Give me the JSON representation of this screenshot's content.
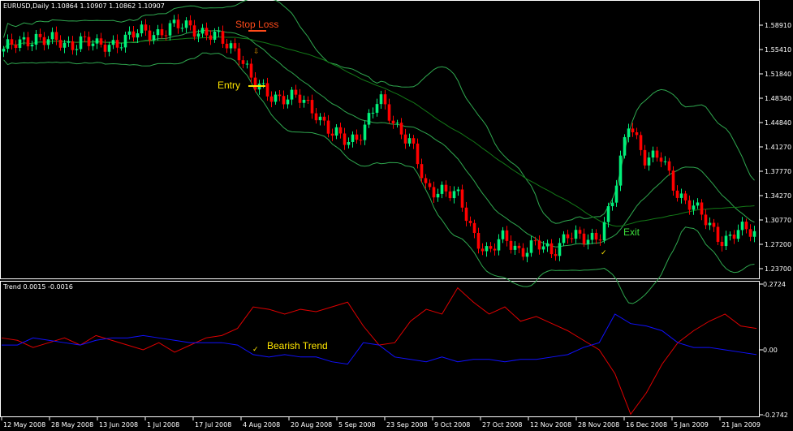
{
  "header": {
    "symbol_info": "EURUSD,Daily  1.10864 1.10907 1.10862 1.10907"
  },
  "indicator": {
    "title": "Trend 0.0015 -0.0016"
  },
  "colors": {
    "up": "#00f07a",
    "down": "#ff0000",
    "bands": "#2fa84f",
    "slow_ma": "#137a17",
    "trend_up": "#e00000",
    "trend_down": "#1010ff",
    "stop_loss": "#ff4a1a",
    "entry": "#ffe600",
    "exit": "#3ce03c"
  },
  "annotations": {
    "stop_loss": "Stop Loss",
    "entry": "Entry",
    "exit": "Exit",
    "bearish_trend": "Bearish Trend"
  },
  "chart_data": [
    {
      "type": "candlestick",
      "title": "EURUSD,Daily",
      "x_tick_labels": [
        "12 May 2008",
        "28 May 2008",
        "13 Jun 2008",
        "1 Jul 2008",
        "17 Jul 2008",
        "4 Aug 2008",
        "20 Aug 2008",
        "5 Sep 2008",
        "23 Sep 2008",
        "9 Oct 2008",
        "27 Oct 2008",
        "12 Nov 2008",
        "28 Nov 2008",
        "16 Dec 2008",
        "5 Jan 2009",
        "21 Jan 2009"
      ],
      "y_tick_labels": [
        "1.58910",
        "1.55410",
        "1.51840",
        "1.48340",
        "1.44840",
        "1.41270",
        "1.37770",
        "1.34270",
        "1.30770",
        "1.27200",
        "1.23700"
      ],
      "ylim": [
        1.207,
        1.624
      ],
      "approx_closes": [
        1.555,
        1.56,
        1.575,
        1.565,
        1.56,
        1.57,
        1.555,
        1.565,
        1.57,
        1.58,
        1.58,
        1.585,
        1.59,
        1.575,
        1.565,
        1.555,
        1.5,
        1.49,
        1.485,
        1.48,
        1.465,
        1.43,
        1.42,
        1.44,
        1.48,
        1.45,
        1.42,
        1.35,
        1.355,
        1.34,
        1.29,
        1.26,
        1.28,
        1.265,
        1.27,
        1.26,
        1.29,
        1.275,
        1.285,
        1.34,
        1.45,
        1.4,
        1.395,
        1.35,
        1.33,
        1.3,
        1.28,
        1.29,
        1.29
      ],
      "overlays": [
        "Bollinger Bands (upper, middle, lower)",
        "slow moving average"
      ]
    },
    {
      "type": "line",
      "title": "Trend 0.0015 -0.0016",
      "y_tick_labels": [
        "0.2724",
        "0.00",
        "-0.2742"
      ],
      "ylim": [
        -0.2742,
        0.2724
      ],
      "series": [
        {
          "name": "Trend up",
          "values": [
            0.05,
            0.04,
            0.01,
            0.03,
            0.05,
            0.02,
            0.06,
            0.04,
            0.02,
            0.0,
            0.03,
            -0.01,
            0.02,
            0.05,
            0.06,
            0.09,
            0.18,
            0.17,
            0.15,
            0.17,
            0.16,
            0.18,
            0.2,
            0.1,
            0.02,
            0.03,
            0.12,
            0.17,
            0.15,
            0.26,
            0.2,
            0.15,
            0.18,
            0.12,
            0.14,
            0.11,
            0.08,
            0.04,
            0.0,
            -0.1,
            -0.27,
            -0.18,
            -0.06,
            0.03,
            0.08,
            0.12,
            0.15,
            0.1,
            0.09
          ]
        },
        {
          "name": "Trend down",
          "values": [
            0.02,
            0.02,
            0.05,
            0.04,
            0.03,
            0.02,
            0.04,
            0.05,
            0.05,
            0.06,
            0.05,
            0.04,
            0.03,
            0.03,
            0.03,
            0.02,
            -0.02,
            -0.03,
            -0.02,
            -0.03,
            -0.03,
            -0.05,
            -0.06,
            0.03,
            0.02,
            -0.03,
            -0.04,
            -0.05,
            -0.03,
            -0.05,
            -0.04,
            -0.04,
            -0.05,
            -0.04,
            -0.04,
            -0.03,
            -0.02,
            0.01,
            0.03,
            0.15,
            0.11,
            0.1,
            0.08,
            0.03,
            0.01,
            0.01,
            0.0,
            -0.01,
            -0.02
          ]
        }
      ]
    }
  ]
}
